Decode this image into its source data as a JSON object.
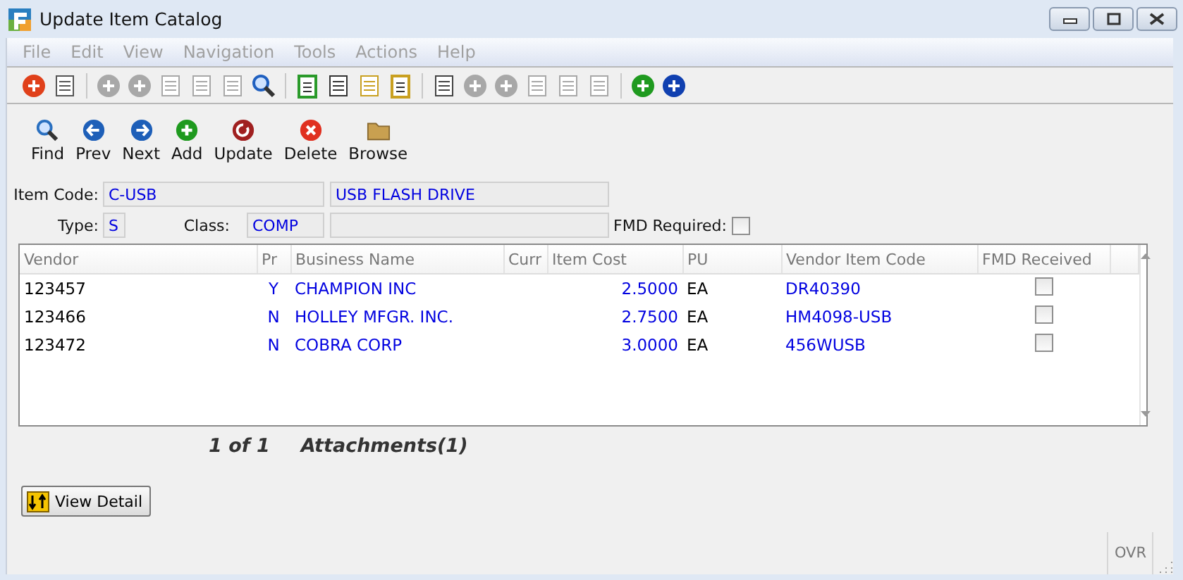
{
  "window": {
    "title": "Update Item Catalog"
  },
  "menu": [
    {
      "label": "File",
      "disabled": true
    },
    {
      "label": "Edit",
      "disabled": true
    },
    {
      "label": "View",
      "disabled": true
    },
    {
      "label": "Navigation",
      "disabled": true
    },
    {
      "label": "Tools",
      "disabled": true
    },
    {
      "label": "Actions",
      "disabled": true
    },
    {
      "label": "Help",
      "disabled": true
    }
  ],
  "icon_toolbar": [
    {
      "disabled": false
    },
    {
      "disabled": false
    },
    {
      "disabled": true
    },
    {
      "disabled": true
    },
    {
      "disabled": true
    },
    {
      "disabled": true
    },
    {
      "disabled": true
    },
    {
      "disabled": false
    },
    {
      "disabled": false
    },
    {
      "disabled": false
    },
    {
      "disabled": false
    },
    {
      "disabled": false
    },
    {
      "disabled": false
    },
    {
      "disabled": true
    },
    {
      "disabled": true
    },
    {
      "disabled": true
    },
    {
      "disabled": true
    },
    {
      "disabled": true
    },
    {
      "disabled": false
    },
    {
      "disabled": false
    }
  ],
  "toolbar": [
    {
      "label": "Find"
    },
    {
      "label": "Prev"
    },
    {
      "label": "Next"
    },
    {
      "label": "Add"
    },
    {
      "label": "Update"
    },
    {
      "label": "Delete"
    },
    {
      "label": "Browse"
    }
  ],
  "form": {
    "item_code_label": "Item Code:",
    "item_code": "C-USB",
    "description": "USB FLASH DRIVE",
    "type_label": "Type:",
    "type": "S",
    "class_label": "Class:",
    "class": "COMP",
    "fmd_required_label": "FMD Required:",
    "fmd_required": false
  },
  "table": {
    "columns": [
      "Vendor",
      "Pr",
      "Business Name",
      "Curr",
      "Item Cost",
      "PU",
      "Vendor Item Code",
      "FMD Received"
    ],
    "rows": [
      {
        "vendor": "123457",
        "pr": "Y",
        "business_name": "CHAMPION INC",
        "item_cost": "2.5000",
        "pu": "EA",
        "vendor_item_code": "DR40390",
        "fmd_received": false
      },
      {
        "vendor": "123466",
        "pr": "N",
        "business_name": "HOLLEY MFGR. INC.",
        "item_cost": "2.7500",
        "pu": "EA",
        "vendor_item_code": "HM4098-USB",
        "fmd_received": false
      },
      {
        "vendor": "123472",
        "pr": "N",
        "business_name": "COBRA CORP",
        "item_cost": "3.0000",
        "pu": "EA",
        "vendor_item_code": "456WUSB",
        "fmd_received": false
      }
    ]
  },
  "record_position": "1 of 1",
  "attachments": "Attachments(1)",
  "view_detail_button": "View Detail",
  "status_bar": {
    "mode": "OVR"
  }
}
